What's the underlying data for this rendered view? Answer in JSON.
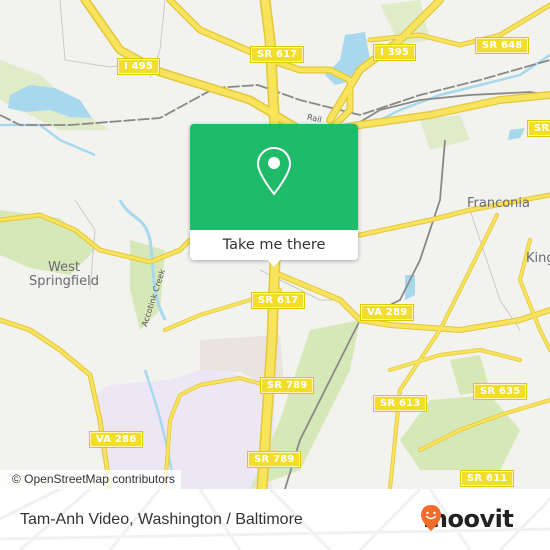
{
  "map": {
    "colors": {
      "background": "#f2f2ef",
      "road": "#f4dc4a",
      "road_casing": "#e3c63a",
      "water": "#a8d8ee",
      "park": "#d6e8b8",
      "military": "#ece6f5",
      "rail": "#777777",
      "popup_green": "#1fba6a",
      "brand_orange": "#f36b2b"
    },
    "road_shields": [
      {
        "id": "i495",
        "label": "I 495"
      },
      {
        "id": "sr617-top",
        "label": "SR 617"
      },
      {
        "id": "i395",
        "label": "I 395"
      },
      {
        "id": "sr648",
        "label": "SR 648"
      },
      {
        "id": "sr-right",
        "label": "SR"
      },
      {
        "id": "sr617-mid",
        "label": "SR 617"
      },
      {
        "id": "va289",
        "label": "VA 289"
      },
      {
        "id": "sr789-a",
        "label": "SR 789"
      },
      {
        "id": "sr613",
        "label": "SR 613"
      },
      {
        "id": "sr635",
        "label": "SR 635"
      },
      {
        "id": "va286",
        "label": "VA 286"
      },
      {
        "id": "sr789-b",
        "label": "SR 789"
      },
      {
        "id": "sr611",
        "label": "SR 611"
      }
    ],
    "places": {
      "west_springfield": "West\nSpringfield",
      "franconia": "Franconia",
      "kingstowne_partial": "King"
    },
    "labels": {
      "creek": "Accotink Creek",
      "rail": "Rail"
    },
    "attribution": "© OpenStreetMap contributors"
  },
  "popup": {
    "icon": "location-pin-icon",
    "button_label": "Take me there"
  },
  "footer": {
    "title": "Tam-Anh Video, Washington / Baltimore",
    "logo_text": "moovit",
    "logo_icon": "moovit-smile-pin-icon"
  }
}
